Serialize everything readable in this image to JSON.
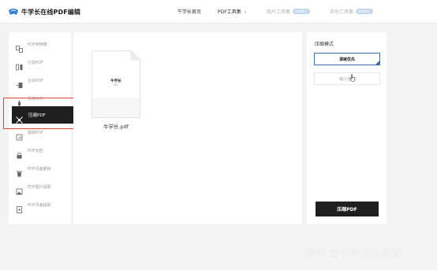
{
  "header": {
    "logo_text": "牛学长在线PDF编辑",
    "nav": {
      "home": "牛学长首页",
      "pdf_tools": "PDF工具集",
      "image_tools": "图片工具集",
      "image_badge": "即将推出",
      "other_tools": "其他工具集",
      "other_badge": "即将推出"
    }
  },
  "sidebar": {
    "items": [
      {
        "label": "PDF转换器",
        "icon": "convert-icon"
      },
      {
        "label": "分割PDF",
        "icon": "split-icon"
      },
      {
        "label": "合并PDF",
        "icon": "merge-icon"
      },
      {
        "label": "添加水印",
        "icon": "watermark-icon"
      },
      {
        "label": "压缩PDF",
        "icon": "compress-icon",
        "active": true
      },
      {
        "label": "旋转PDF",
        "icon": "rotate-icon"
      },
      {
        "label": "PDF加密",
        "icon": "lock-icon"
      },
      {
        "label": "PDF页面删除",
        "icon": "trash-icon"
      },
      {
        "label": "PDF图片提取",
        "icon": "image-extract-icon"
      },
      {
        "label": "PDF页面提取",
        "icon": "page-extract-icon"
      }
    ]
  },
  "main": {
    "file": {
      "thumb_title": "牛学长",
      "thumb_sub": "PDF",
      "name": "牛学长.pdf"
    }
  },
  "panel": {
    "title": "压缩模式",
    "options": [
      "清晰优先",
      "缩小优先"
    ],
    "selected": "清晰优先",
    "action_label": "压缩PDF"
  },
  "overlay": {
    "watermark": "知乎 @牛学长工具箱"
  },
  "colors": {
    "accent": "#3c6ea9",
    "active_bg": "#1f1f1f",
    "highlight": "#d9443a"
  }
}
